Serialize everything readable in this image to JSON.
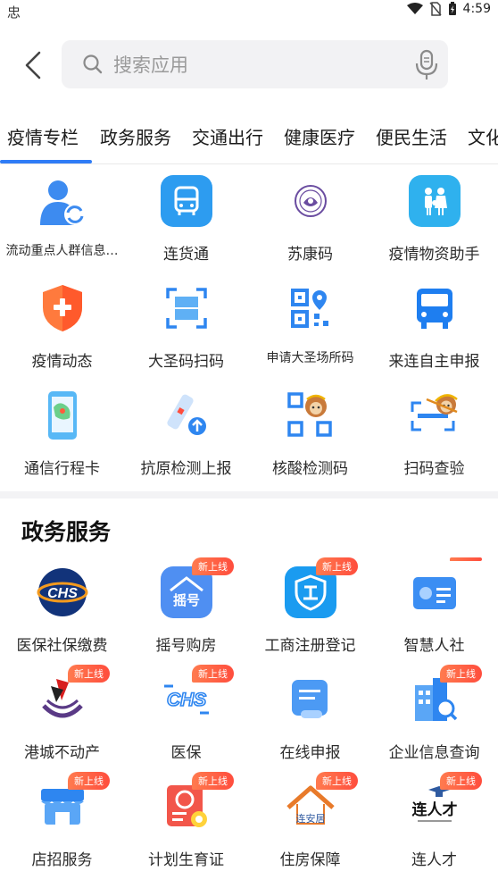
{
  "status_bar": {
    "carrier_glyph": "忠",
    "time": "4:59"
  },
  "search": {
    "placeholder": "搜索应用"
  },
  "tabs": [
    "疫情专栏",
    "政务服务",
    "交通出行",
    "健康医疗",
    "便民生活",
    "文化"
  ],
  "section1": {
    "items": [
      {
        "label": "流动重点人群信息…",
        "icon": "person-sync-icon"
      },
      {
        "label": "连货通",
        "icon": "bus-icon"
      },
      {
        "label": "苏康码",
        "icon": "seal-icon"
      },
      {
        "label": "疫情物资助手",
        "icon": "family-icon"
      },
      {
        "label": "疫情动态",
        "icon": "shield-plus-icon"
      },
      {
        "label": "大圣码扫码",
        "icon": "scan-frame-icon"
      },
      {
        "label": "申请大圣场所码",
        "icon": "qr-pin-icon"
      },
      {
        "label": "来连自主申报",
        "icon": "bus-front-icon"
      },
      {
        "label": "通信行程卡",
        "icon": "phone-map-icon"
      },
      {
        "label": "抗原检测上报",
        "icon": "test-upload-icon"
      },
      {
        "label": "核酸检测码",
        "icon": "monkey-qr-icon"
      },
      {
        "label": "扫码查验",
        "icon": "monkey-scan-icon"
      }
    ]
  },
  "section2": {
    "title": "政务服务",
    "badge": "新上线",
    "items": [
      {
        "label": "医保社保缴费",
        "icon": "chs-globe-icon",
        "new": false
      },
      {
        "label": "摇号购房",
        "icon": "house-lottery-icon",
        "new": true
      },
      {
        "label": "工商注册登记",
        "icon": "shield-gong-icon",
        "new": true
      },
      {
        "label": "智慧人社",
        "icon": "id-card-icon",
        "new": true
      },
      {
        "label": "港城不动产",
        "icon": "ship-logo-icon",
        "new": true
      },
      {
        "label": "医保",
        "icon": "chs-text-icon",
        "new": true
      },
      {
        "label": "在线申报",
        "icon": "doc-pen-icon",
        "new": false
      },
      {
        "label": "企业信息查询",
        "icon": "building-search-icon",
        "new": true
      },
      {
        "label": "店招服务",
        "icon": "storefront-icon",
        "new": true
      },
      {
        "label": "计划生育证",
        "icon": "certificate-icon",
        "new": true
      },
      {
        "label": "住房保障",
        "icon": "house-logo-icon",
        "new": true
      },
      {
        "label": "连人才",
        "icon": "talent-logo-icon",
        "new": true
      }
    ]
  }
}
